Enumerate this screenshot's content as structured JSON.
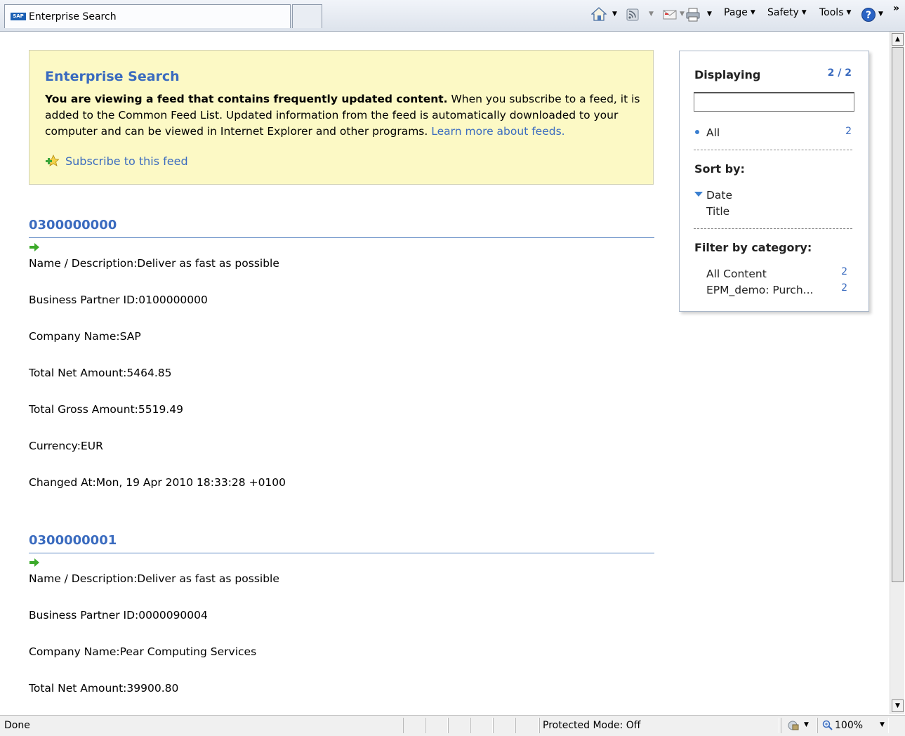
{
  "browser": {
    "tab_title": "Enterprise Search",
    "tab_logo": "SAP",
    "commands": {
      "page": "Page",
      "safety": "Safety",
      "tools": "Tools",
      "more": "»"
    }
  },
  "banner": {
    "title": "Enterprise Search",
    "bold_text": "You are viewing a feed that contains frequently updated content.",
    "body_text": " When you subscribe to a feed, it is added to the Common Feed List. Updated information from the feed is automatically downloaded to your computer and can be viewed in Internet Explorer and other programs. ",
    "learn_more": "Learn more about feeds.",
    "subscribe": "Subscribe to this feed"
  },
  "entries": [
    {
      "title": "0300000000",
      "fields": [
        "Name / Description:Deliver as fast as possible",
        "Business Partner ID:0100000000",
        "Company Name:SAP",
        "Total Net Amount:5464.85",
        "Total Gross Amount:5519.49",
        "Currency:EUR",
        "Changed At:Mon, 19 Apr 2010 18:33:28 +0100"
      ]
    },
    {
      "title": "0300000001",
      "fields": [
        "Name / Description:Deliver as fast as possible",
        "Business Partner ID:0000090004",
        "Company Name:Pear Computing Services",
        "Total Net Amount:39900.80"
      ]
    }
  ],
  "panel": {
    "displaying_label": "Displaying",
    "displaying_count": "2 / 2",
    "filter_value": "",
    "all_label": "All",
    "all_count": "2",
    "sort_label": "Sort by:",
    "sort_date": "Date",
    "sort_title": "Title",
    "category_label": "Filter by category:",
    "categories": [
      {
        "label": "All Content",
        "count": "2"
      },
      {
        "label": "EPM_demo: Purch...",
        "count": "2"
      }
    ]
  },
  "status": {
    "text": "Done",
    "protected_mode": "Protected Mode: Off",
    "zoom": "100%"
  },
  "colors": {
    "link": "#3a6bbf",
    "banner_bg": "#fcf9c5"
  }
}
